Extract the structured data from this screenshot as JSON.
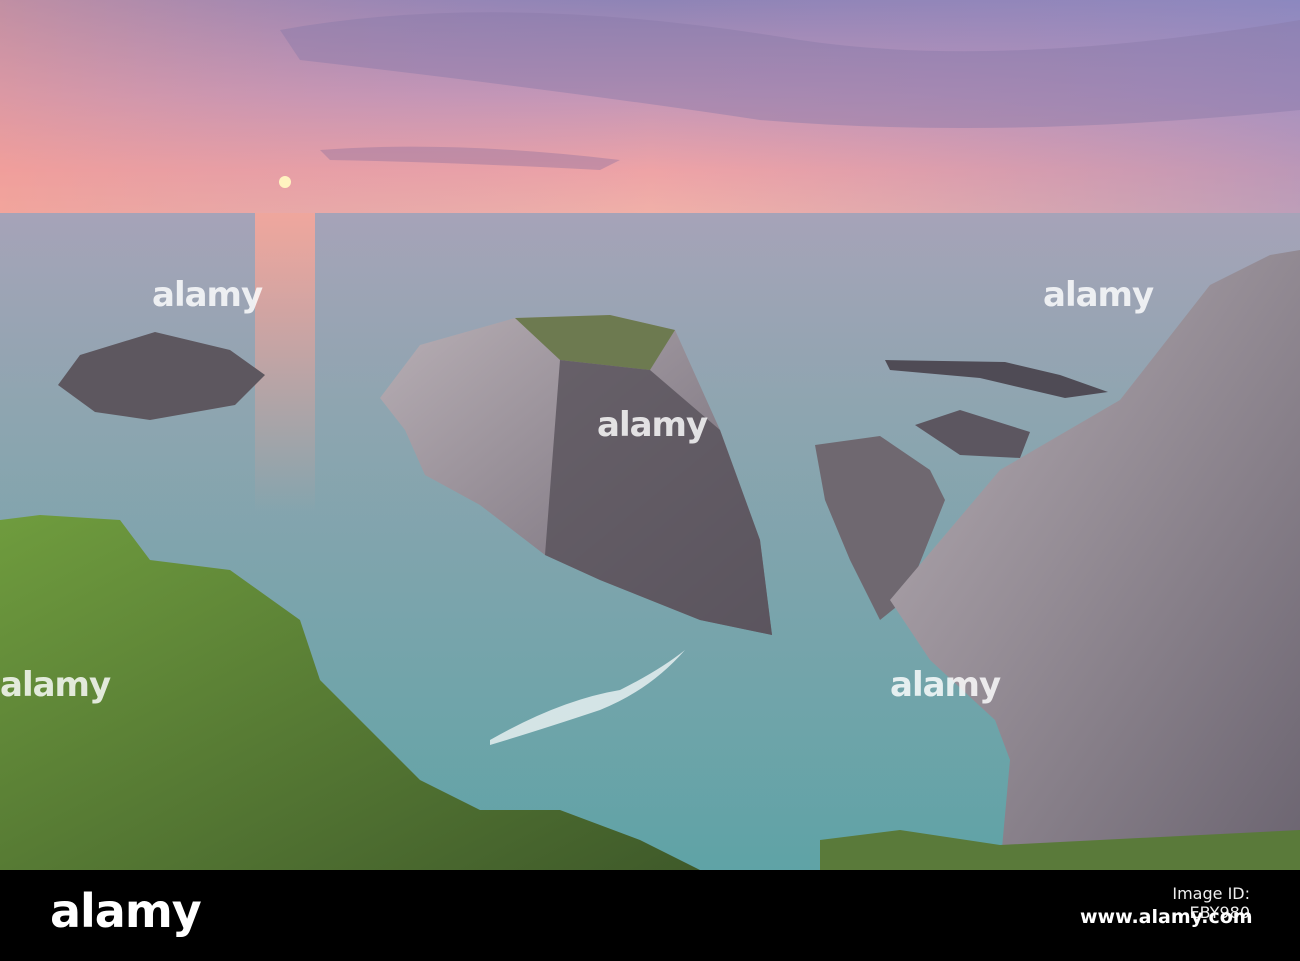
{
  "watermark": "alamy",
  "footer": {
    "logo": "alamy",
    "image_id": "Image ID: EBY980",
    "url": "www.alamy.com"
  },
  "colors": {
    "sky_top": "#8c86b8",
    "sky_horizon": "#f1a3a0",
    "sea": "#7fa3ad",
    "lagoon": "#6fb3b1",
    "rock": "#8f8790",
    "grass": "#5f8a3a"
  }
}
